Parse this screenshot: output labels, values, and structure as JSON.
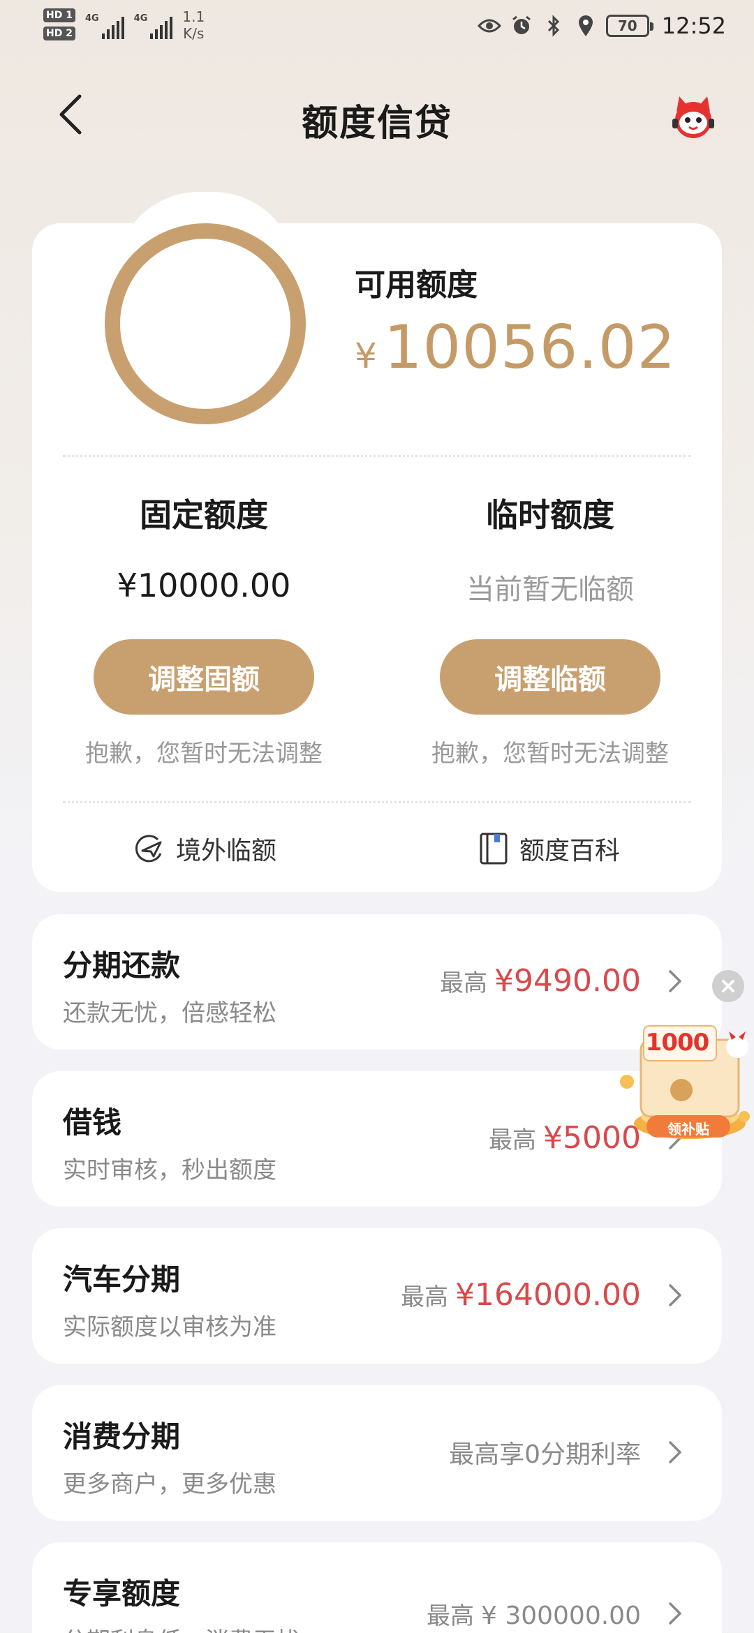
{
  "status_bar": {
    "hd1": "HD 1",
    "hd2": "HD 2",
    "net1": "4G",
    "net2": "4G",
    "speed_value": "1.1",
    "speed_unit": "K/s",
    "battery": "70",
    "time": "12:52"
  },
  "header": {
    "title": "额度信贷"
  },
  "credit": {
    "available_label": "可用额度",
    "currency_symbol": "¥",
    "available_amount": "10056.02",
    "fixed": {
      "title": "固定额度",
      "value": "¥10000.00",
      "button": "调整固额",
      "note": "抱歉，您暂时无法调整"
    },
    "temp": {
      "title": "临时额度",
      "value": "当前暂无临额",
      "button": "调整临额",
      "note": "抱歉，您暂时无法调整"
    },
    "links": {
      "overseas": "境外临额",
      "encyclopedia": "额度百科"
    }
  },
  "products": [
    {
      "title": "分期还款",
      "subtitle": "还款无忧，倍感轻松",
      "prefix": "最高",
      "amount": "¥9490.00"
    },
    {
      "title": "借钱",
      "subtitle": "实时审核，秒出额度",
      "prefix": "最高",
      "amount": "¥5000"
    },
    {
      "title": "汽车分期",
      "subtitle": "实际额度以审核为准",
      "prefix": "最高",
      "amount": "¥164000.00"
    },
    {
      "title": "消费分期",
      "subtitle": "更多商户，更多优惠",
      "prefix": "",
      "amount": "最高享0分期利率"
    },
    {
      "title": "专享额度",
      "subtitle": "分期利息低，消费无忧",
      "prefix": "最高",
      "amount": "¥ 300000.00"
    }
  ],
  "promo": {
    "amount": "1000",
    "label": "领补贴"
  },
  "colors": {
    "accent_gold": "#c8a06f",
    "amount_red": "#d9494b"
  }
}
